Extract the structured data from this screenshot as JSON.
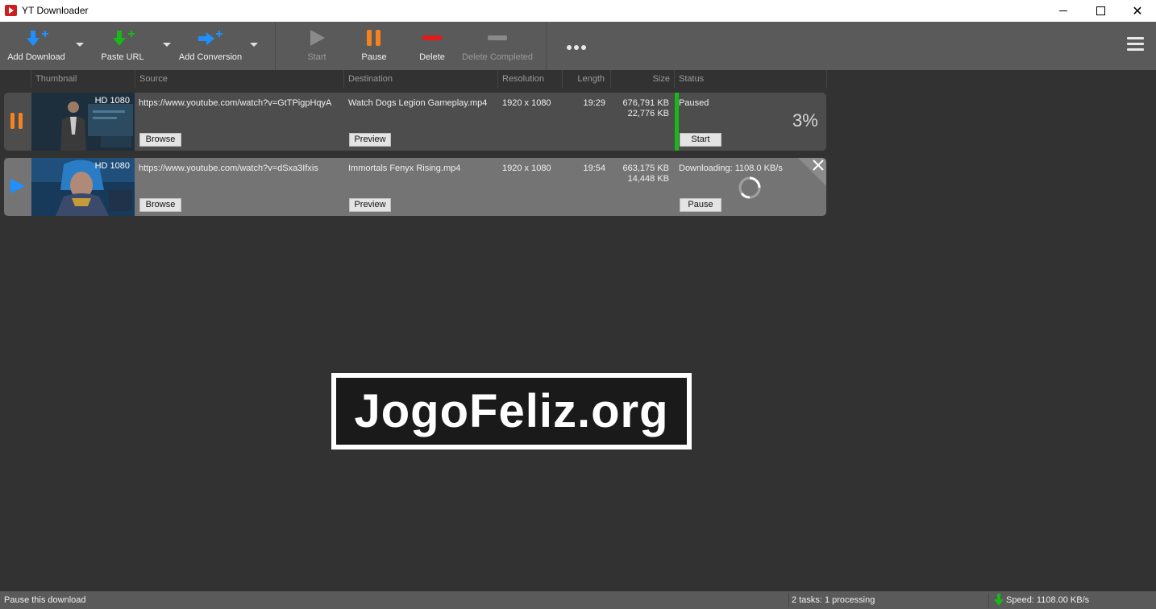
{
  "window": {
    "title": "YT Downloader",
    "icon": "youtube-icon"
  },
  "toolbar": {
    "add_download": "Add Download",
    "paste_url": "Paste URL",
    "add_conversion": "Add Conversion",
    "start": "Start",
    "pause": "Pause",
    "delete": "Delete",
    "delete_completed": "Delete Completed",
    "more_icon": "more-horizontal-icon",
    "menu_icon": "hamburger-menu-icon"
  },
  "columns": {
    "thumbnail": "Thumbnail",
    "source": "Source",
    "destination": "Destination",
    "resolution": "Resolution",
    "length": "Length",
    "size": "Size",
    "status": "Status"
  },
  "downloads": [
    {
      "quality_badge": "HD 1080",
      "source": "https://www.youtube.com/watch?v=GtTPigpHqyA",
      "destination": "Watch Dogs  Legion Gameplay.mp4",
      "resolution": "1920 x 1080",
      "length": "19:29",
      "size_total": "676,791 KB",
      "size_done": "22,776 KB",
      "status": "Paused",
      "progress_text": "3%",
      "browse_label": "Browse",
      "preview_label": "Preview",
      "action_label": "Start",
      "state_icon": "pause-icon"
    },
    {
      "quality_badge": "HD 1080",
      "source": "https://www.youtube.com/watch?v=dSxa3Ifxis",
      "destination": "Immortals Fenyx Rising.mp4",
      "resolution": "1920 x 1080",
      "length": "19:54",
      "size_total": "663,175 KB",
      "size_done": "14,448 KB",
      "status": "Downloading: 1108.0 KB/s",
      "browse_label": "Browse",
      "preview_label": "Preview",
      "action_label": "Pause",
      "state_icon": "play-icon"
    }
  ],
  "watermark": "JogoFeliz.org",
  "statusbar": {
    "hint": "Pause this download",
    "tasks": "2 tasks: 1 processing",
    "speed": "Speed: 1108.00 KB/s"
  },
  "colors": {
    "background": "#323232",
    "toolbar": "#5a5a5a",
    "accent_blue": "#1e90ff",
    "accent_green": "#17b817",
    "accent_orange": "#f5821f",
    "delete_red": "#e21b1b"
  }
}
